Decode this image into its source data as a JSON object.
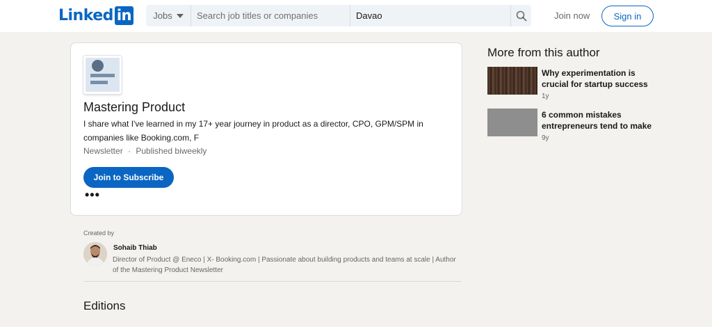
{
  "header": {
    "logo_text": "Linked",
    "logo_in": "in",
    "jobs_label": "Jobs",
    "search_placeholder": "Search job titles or companies",
    "location_value": "Davao",
    "join_now": "Join now",
    "sign_in": "Sign in"
  },
  "newsletter": {
    "title": "Mastering Product",
    "description": "I share what I've learned in my 17+ year journey in product as a director, CPO, GPM/SPM in companies like Booking.com, F",
    "type": "Newsletter",
    "separator": "·",
    "frequency": "Published biweekly",
    "subscribe_label": "Join to Subscribe",
    "more_label": "•••"
  },
  "created_by": {
    "label": "Created by",
    "author_name": "Sohaib Thiab",
    "author_headline": "Director of Product @ Eneco | X- Booking.com | Passionate about building products and teams at scale | Author of the Mastering Product Newsletter"
  },
  "editions": {
    "title": "Editions"
  },
  "sidebar": {
    "title": "More from this author",
    "articles": [
      {
        "title": "Why experimentation is crucial for startup success",
        "time": "1y"
      },
      {
        "title": "6 common mistakes entrepreneurs tend to make",
        "time": "9y"
      }
    ]
  },
  "colors": {
    "brand": "#0a66c2",
    "page_bg": "#f3f2ef",
    "search_bg": "#eef3f8"
  },
  "icons": {
    "search": "search-icon",
    "caret": "caret-down-icon"
  }
}
